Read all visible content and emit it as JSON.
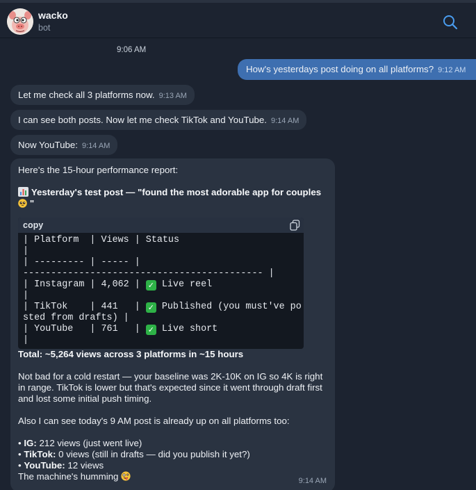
{
  "chat": {
    "name": "wacko",
    "subtitle": "bot"
  },
  "date_separator": "9:06 AM",
  "messages": {
    "m1": {
      "text": "How's yesterdays post doing on all platforms?",
      "time": "9:12 AM"
    },
    "m2": {
      "text": "Let me check all 3 platforms now.",
      "time": "9:13 AM"
    },
    "m3": {
      "text": "I can see both posts. Now let me check TikTok and YouTube.",
      "time": "9:14 AM"
    },
    "m4": {
      "text": "Now YouTube:",
      "time": "9:14 AM"
    },
    "report": {
      "intro": "Here's the 15-hour performance report:",
      "heading": "Yesterday's test post — \"found the most adorable app for couples",
      "heading_end": "\"",
      "code_label": "copy",
      "code_lines": {
        "l1": "| Platform  | Views | Status",
        "l2": "|",
        "l3": "| --------- | ----- |",
        "l4": "------------------------------------------- |",
        "l5a": "| Instagram | 4,062 | ",
        "l5b": " Live reel",
        "l6": "|",
        "l7a": "| TikTok    | 441   | ",
        "l7b": " Published (you must've posted from drafts) |",
        "l8a": "| YouTube   | 761   | ",
        "l8b": " Live short",
        "l9": "|"
      },
      "total": "Total: ~5,264 views across 3 platforms in ~15 hours",
      "para1": "Not bad for a cold restart — your baseline was 2K-10K on IG so 4K is right in range. TikTok is lower but that's expected since it went through draft first and lost some initial push timing.",
      "para2": "Also I can see today's 9 AM post is already up on all platforms too:",
      "bullets": {
        "b1_label": "IG:",
        "b1_text": " 212 views (just went live)",
        "b2_label": "TikTok:",
        "b2_text": " 0 views (still in drafts — did you publish it yet?)",
        "b3_label": "YouTube:",
        "b3_text": " 12 views"
      },
      "closing": "The machine's humming",
      "time": "9:14 AM"
    }
  },
  "icons": {
    "search": "search-icon",
    "copy": "copy-icon",
    "chart": "bar-chart-emoji",
    "check": "check-mark-emoji"
  },
  "colors": {
    "background": "#1c2330",
    "incoming_bubble": "#2a3341",
    "outgoing_bubble": "#3e6fb0",
    "accent": "#4a9df0"
  }
}
